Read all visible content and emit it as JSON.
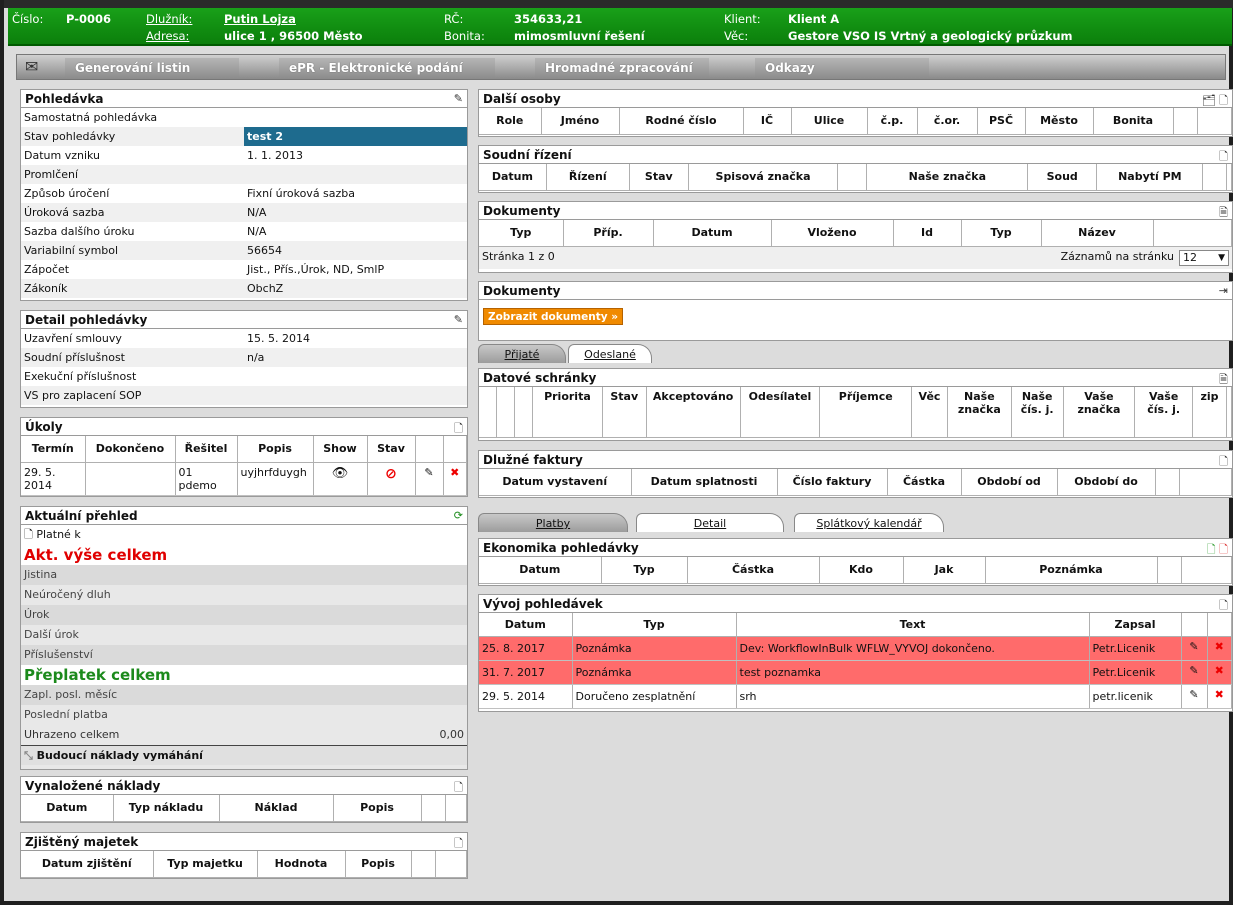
{
  "header": {
    "cislo_label": "Číslo:",
    "cislo_value": "P-0006",
    "dluznik_label": "Dlužník:",
    "dluznik_value": "Putin Lojza",
    "adresa_label": "Adresa:",
    "adresa_value": "ulice 1 , 96500 Město",
    "rc_label": "RČ:",
    "rc_value": "354633,21",
    "bonita_label": "Bonita:",
    "bonita_value": "mimosmluvní řešení",
    "klient_label": "Klient:",
    "klient_value": "Klient A",
    "vec_label": "Věc:",
    "vec_value": "Gestore VSO IS Vrtný a geologický průzkum"
  },
  "menu": [
    "Generování listin",
    "ePR - Elektronické podání",
    "Hromadné zpracování",
    "Odkazy"
  ],
  "pohledavka": {
    "title": "Pohledávka",
    "rows": [
      {
        "k": "Samostatná pohledávka",
        "v": ""
      },
      {
        "k": "Stav pohledávky",
        "v": "test 2"
      },
      {
        "k": "Datum vzniku",
        "v": "1. 1. 2013"
      },
      {
        "k": "Promlčení",
        "v": ""
      },
      {
        "k": "Způsob úročení",
        "v": "Fixní úroková sazba"
      },
      {
        "k": "Úroková sazba",
        "v": "N/A"
      },
      {
        "k": "Sazba dalšího úroku",
        "v": "N/A"
      },
      {
        "k": "Variabilní symbol",
        "v": "56654"
      },
      {
        "k": "Zápočet",
        "v": "Jist., Přís.,Úrok, ND, SmlP"
      },
      {
        "k": "Zákoník",
        "v": "ObchZ"
      }
    ]
  },
  "detail": {
    "title": "Detail pohledávky",
    "rows": [
      {
        "k": "Uzavření smlouvy",
        "v": "15. 5. 2014"
      },
      {
        "k": "Soudní příslušnost",
        "v": "n/a"
      },
      {
        "k": "Exekuční příslušnost",
        "v": ""
      },
      {
        "k": "VS pro zaplacení SOP",
        "v": ""
      }
    ]
  },
  "ukoly": {
    "title": "Úkoly",
    "cols": [
      "Termín",
      "Dokončeno",
      "Řešitel",
      "Popis",
      "Show",
      "Stav"
    ],
    "row": {
      "termin": "29. 5. 2014",
      "dokonceno": "",
      "resitel": "01 pdemo",
      "popis": "uyjhrfduygh"
    }
  },
  "prehled": {
    "title": "Aktuální přehled",
    "platne": "Platné k",
    "akt": "Akt. výše celkem",
    "items1": [
      "Jistina",
      "Neúročený dluh",
      "Úrok",
      "Další úrok",
      "Příslušenství"
    ],
    "preplatek": "Přeplatek celkem",
    "items2": [
      "Zapl. posl. měsíc",
      "Poslední platba"
    ],
    "uhrazeno": "Uhrazeno celkem",
    "uhrazeno_value": "0,00",
    "budouci": "Budoucí náklady vymáhání"
  },
  "naklady": {
    "title": "Vynaložené náklady",
    "cols": [
      "Datum",
      "Typ nákladu",
      "Náklad",
      "Popis"
    ]
  },
  "majetek": {
    "title": "Zjištěný majetek",
    "cols": [
      "Datum zjištění",
      "Typ majetku",
      "Hodnota",
      "Popis"
    ]
  },
  "osoby": {
    "title": "Další osoby",
    "cols": [
      "Role",
      "Jméno",
      "Rodné číslo",
      "IČ",
      "Ulice",
      "č.p.",
      "č.or.",
      "PSČ",
      "Město",
      "Bonita"
    ]
  },
  "soud": {
    "title": "Soudní řízení",
    "cols": [
      "Datum",
      "Řízení",
      "Stav",
      "Spisová značka",
      "",
      "Naše značka",
      "Soud",
      "Nabytí PM"
    ]
  },
  "dokumenty1": {
    "title": "Dokumenty",
    "cols": [
      "Typ",
      "Příp.",
      "Datum",
      "Vloženo",
      "Id",
      "Typ",
      "Název"
    ],
    "pager": "Stránka 1 z 0",
    "per_page_label": "Záznamů na stránku",
    "per_page": "12"
  },
  "dokumenty2": {
    "title": "Dokumenty",
    "button": "Zobrazit dokumenty »"
  },
  "ds_tabs": [
    "Přijaté",
    "Odeslané"
  ],
  "schranky": {
    "title": "Datové schránky",
    "cols": [
      "Priorita",
      "Stav",
      "Akceptováno",
      "Odesílatel",
      "Příjemce",
      "Věc",
      "Naše značka",
      "Naše čís. j.",
      "Vaše značka",
      "Vaše čís. j.",
      "zip"
    ]
  },
  "faktury": {
    "title": "Dlužné faktury",
    "cols": [
      "Datum vystavení",
      "Datum splatnosti",
      "Číslo faktury",
      "Částka",
      "Období od",
      "Období do"
    ]
  },
  "eko_tabs": [
    "Platby",
    "Detail",
    "Splátkový kalendář"
  ],
  "ekonomika": {
    "title": "Ekonomika pohledávky",
    "cols": [
      "Datum",
      "Typ",
      "Částka",
      "Kdo",
      "Jak",
      "Poznámka"
    ]
  },
  "vyvoj": {
    "title": "Vývoj pohledávek",
    "cols": [
      "Datum",
      "Typ",
      "Text",
      "Zapsal"
    ],
    "rows": [
      {
        "datum": "25. 8. 2017",
        "typ": "Poznámka",
        "text": "Dev: WorkflowInBulk WFLW_VYVOJ dokončeno.",
        "zapsal": "Petr.Licenik"
      },
      {
        "datum": "31. 7. 2017",
        "typ": "Poznámka",
        "text": "test poznamka",
        "zapsal": "Petr.Licenik"
      },
      {
        "datum": "29. 5. 2014",
        "typ": "Doručeno zesplatnění",
        "text": "srh",
        "zapsal": "petr.licenik"
      }
    ]
  }
}
